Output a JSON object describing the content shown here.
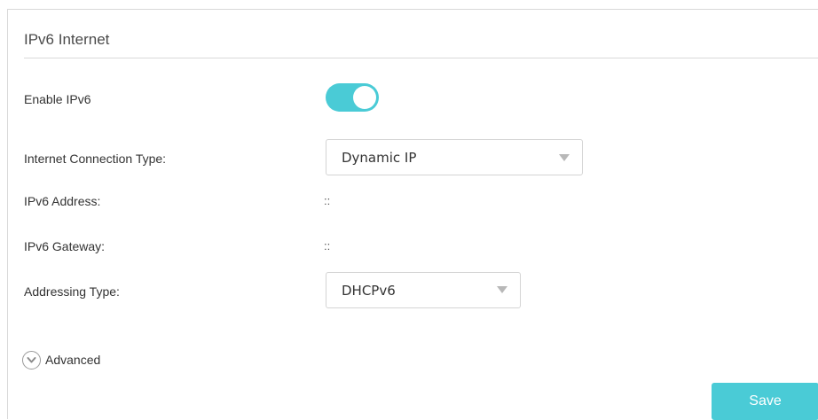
{
  "section": {
    "title": "IPv6 Internet"
  },
  "fields": {
    "enable_ipv6": {
      "label": "Enable IPv6",
      "enabled": true
    },
    "connection_type": {
      "label": "Internet Connection Type:",
      "value": "Dynamic IP"
    },
    "ipv6_address": {
      "label": "IPv6 Address:",
      "value": "::"
    },
    "ipv6_gateway": {
      "label": "IPv6 Gateway:",
      "value": "::"
    },
    "addressing_type": {
      "label": "Addressing Type:",
      "value": "DHCPv6"
    }
  },
  "advanced": {
    "label": "Advanced",
    "icon": "chevron-down-circle-icon"
  },
  "actions": {
    "save_label": "Save"
  },
  "colors": {
    "accent": "#4acbd6",
    "border": "#d9d9d9",
    "text": "#333333"
  }
}
